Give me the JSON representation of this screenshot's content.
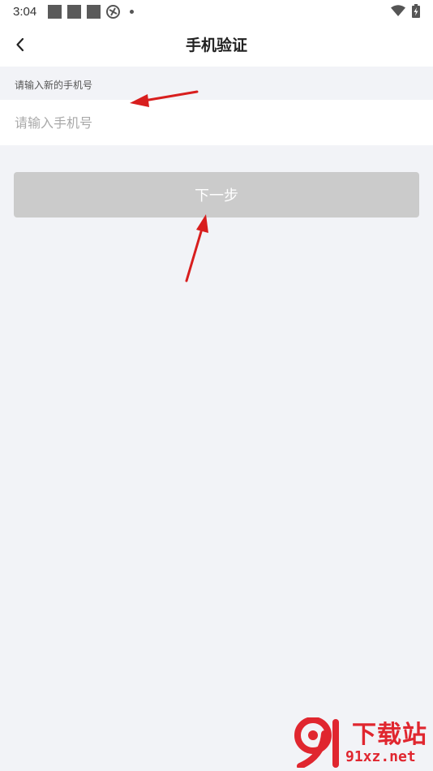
{
  "status_bar": {
    "time": "3:04",
    "icons": [
      "notification-square",
      "notification-square",
      "notification-square",
      "app-notification-icon",
      "dot-icon",
      "wifi-icon",
      "battery-charging-icon"
    ]
  },
  "header": {
    "title": "手机验证",
    "back_icon": "chevron-left-icon"
  },
  "form": {
    "label": "请输入新的手机号",
    "phone_value": "",
    "phone_placeholder": "请输入手机号",
    "next_label": "下一步"
  },
  "colors": {
    "page_bg": "#f2f3f7",
    "disabled_button": "#cbcbcb",
    "annotation_arrow": "#d81e1e",
    "watermark": "#e0262f"
  },
  "watermark": {
    "title": "下载站",
    "domain": "91xz.net"
  }
}
